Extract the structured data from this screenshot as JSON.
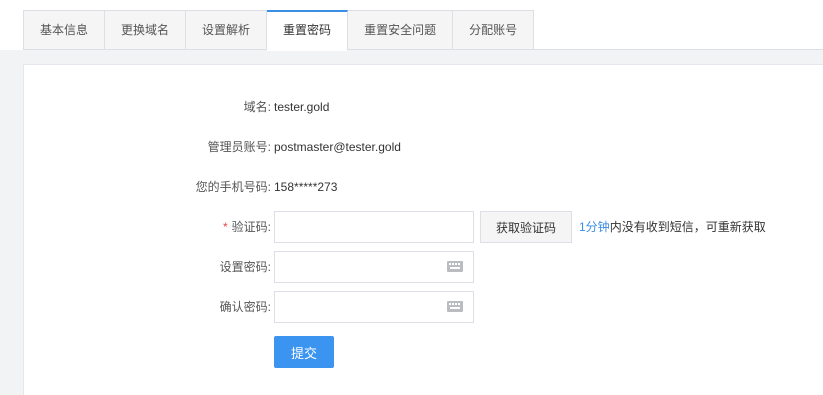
{
  "tabs": [
    {
      "label": "基本信息"
    },
    {
      "label": "更换域名"
    },
    {
      "label": "设置解析"
    },
    {
      "label": "重置密码"
    },
    {
      "label": "重置安全问题"
    },
    {
      "label": "分配账号"
    }
  ],
  "active_tab": "重置密码",
  "form": {
    "domain_label": "域名:",
    "domain_value": "tester.gold",
    "admin_label": "管理员账号:",
    "admin_value": "postmaster@tester.gold",
    "phone_label": "您的手机号码:",
    "phone_value": "158*****273",
    "required_mark": "*",
    "code_label": "验证码:",
    "code_value": "",
    "get_code_button": "获取验证码",
    "hint_accent": "1分钟",
    "hint_rest": "内没有收到短信，可重新获取",
    "set_password_label": "设置密码:",
    "set_password_value": "",
    "confirm_password_label": "确认密码:",
    "confirm_password_value": "",
    "submit_button": "提交"
  },
  "icons": {
    "keyboard": "keyboard-icon"
  },
  "colors": {
    "accent": "#3a8ee6",
    "submit": "#3a94f0",
    "required": "#e64545"
  }
}
